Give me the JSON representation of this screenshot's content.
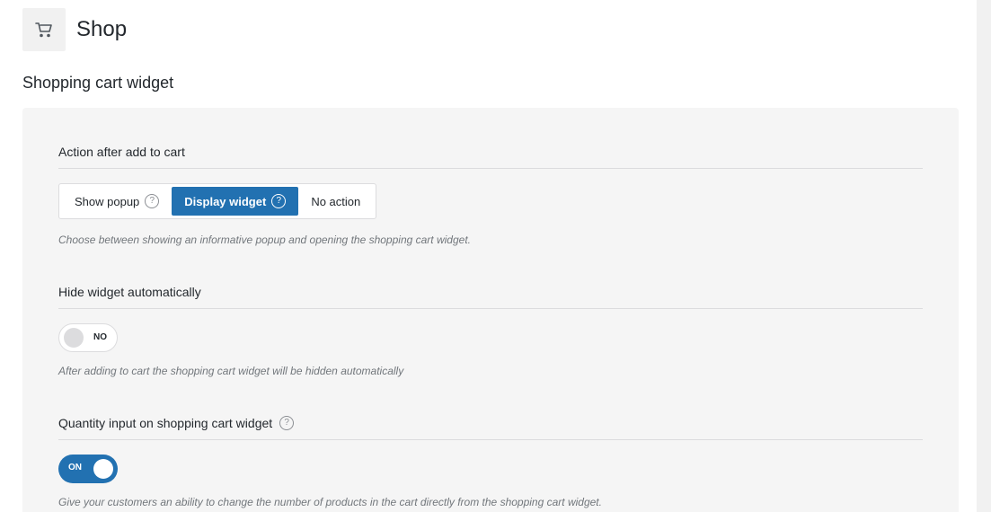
{
  "header": {
    "title": "Shop",
    "icon": "shopping-cart-icon"
  },
  "section": {
    "title": "Shopping cart widget"
  },
  "settings": {
    "action_after_add": {
      "label": "Action after add to cart",
      "options": [
        {
          "label": "Show popup",
          "help": "?"
        },
        {
          "label": "Display widget",
          "help": "?"
        },
        {
          "label": "No action"
        }
      ],
      "selected": "Display widget",
      "description": "Choose between showing an informative popup and opening the shopping cart widget."
    },
    "hide_widget": {
      "label": "Hide widget automatically",
      "toggle_text": "NO",
      "description": "After adding to cart the shopping cart widget will be hidden automatically"
    },
    "quantity_input": {
      "label": "Quantity input on shopping cart widget",
      "help": "?",
      "toggle_text": "ON",
      "description": "Give your customers an ability to change the number of products in the cart directly from the shopping cart widget."
    }
  },
  "colors": {
    "accent": "#2271b1",
    "panel_bg": "#f5f5f5"
  }
}
